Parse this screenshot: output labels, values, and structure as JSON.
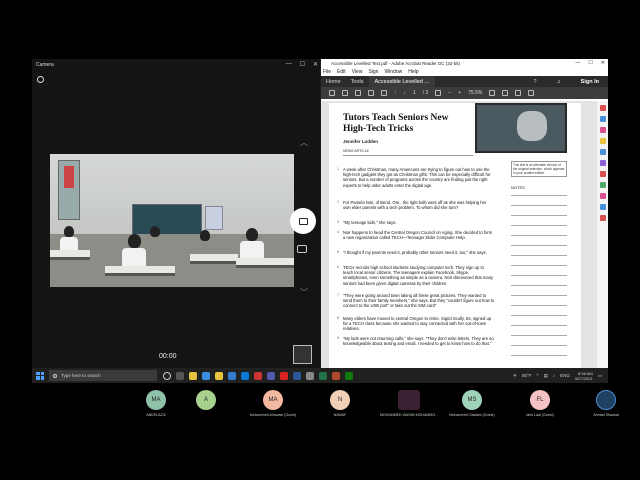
{
  "camera": {
    "title": "Camera",
    "min": "—",
    "max": "☐",
    "close": "✕",
    "timer": "00:00"
  },
  "acrobat": {
    "title": "Accessible Levelled Text.pdf - Adobe Acrobat Reader DC (32-bit)",
    "menu": [
      "File",
      "Edit",
      "View",
      "Sign",
      "Window",
      "Help"
    ],
    "tabs": {
      "home": "Home",
      "tools": "Tools",
      "doc": "Accessible Levelled ..."
    },
    "sign_in": "Sign In",
    "page_current": "1",
    "page_total": "/ 2",
    "zoom": "75.5%",
    "article": {
      "title": "Tutors Teach Seniors New High-Tech Tricks",
      "author": "Jennifer Ludden",
      "kind": "NEWS ARTICLE",
      "caption": "This text is an alternate version of the original selection, which appears in your student edition.",
      "notes_label": "NOTES",
      "paragraphs": [
        {
          "n": "1",
          "text": "A week after Christmas, many Americans are trying to figure out how to use the high-tech gadgets they got as Christmas gifts. This can be especially difficult for seniors. But a number of programs across the country are finding just the right experts to help older adults enter the digital age."
        },
        {
          "n": "2",
          "text": "For Pamela Noir, of Bend, Ore., the light bulb went off as she was helping her own elder parents with a tech problem. To whom did she turn?"
        },
        {
          "n": "3",
          "text": "\"My teenage kids,\" she says."
        },
        {
          "n": "4",
          "text": "Noir happens to head the Central Oregon Council on Aging. She decided to form a new organization called TECH—Teenager Elder Computer Help."
        },
        {
          "n": "5",
          "text": "\"I thought if my parents need it, probably other seniors need it, too,\" she says."
        },
        {
          "n": "6",
          "text": "TECH recruits high school students studying computer tech. They sign up to teach local senior citizens. The teenagers explain Facebook, Skype, smartphones, even something as simple as a camera. Noir discovered that many seniors had been given digital cameras by their children."
        },
        {
          "n": "7",
          "text": "\"They were going around town taking all these great pictures. They wanted to send them to their family members,\" she says. But they \"couldn't figure out how to connect to the USB port\" or take out the SIM card\""
        },
        {
          "n": "8",
          "text": "Many elders have moved to central Oregon to retire. Sigrid Scully, 84, signed up for a TECH class because she wanted to stay connected with her out-of-town relatives."
        },
        {
          "n": "9",
          "text": "\"My kids were not returning calls,\" she says. \"They don't write letters. They are so knowledgeable about texting and email. I needed to get to know how to do that.\""
        }
      ]
    }
  },
  "taskbar": {
    "search_placeholder": "Type here to search",
    "weather": "85°F",
    "lang": "ENG",
    "time": "8:58 AM",
    "date": "5/27/2021"
  },
  "participants": [
    {
      "initials": "MA",
      "name": "ABDELAZIZ",
      "color": "#8fc0a8"
    },
    {
      "initials": "A",
      "name": "",
      "color": "#a9d18e"
    },
    {
      "initials": "MA",
      "name": "Mohammed Alrowaei (Guest)",
      "color": "#f2b8a0"
    },
    {
      "initials": "N",
      "name": "NAWAF",
      "color": "#f2d0b8"
    },
    {
      "initials": "",
      "name": "MOHAMMED WASIM MOHAMMO...",
      "color": "#3a2030"
    },
    {
      "initials": "MS",
      "name": "Mohammed Saalam (Guest)",
      "color": "#9fd3b8"
    },
    {
      "initials": "FL",
      "name": "faris  Laal  (Guest)",
      "color": "#f4c2c2"
    },
    {
      "initials": "",
      "name": "Ahmad Shaukat",
      "color": "#204060"
    }
  ]
}
